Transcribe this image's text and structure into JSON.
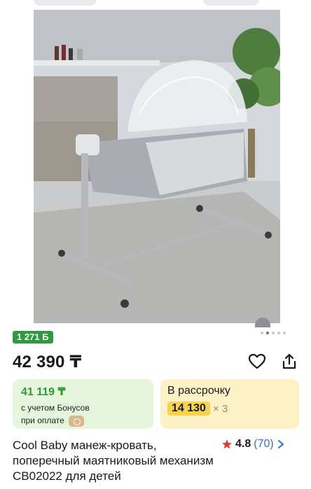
{
  "gallery": {
    "image_alt": "product photo",
    "dots_count": 5,
    "active_dot": 1
  },
  "bonus_badge": "1 271 Б",
  "price": "42 390 ₸",
  "actions": {
    "favorite_icon": "heart-icon",
    "share_icon": "share-icon"
  },
  "bonus_card": {
    "amount": "41 119 ₸",
    "line1": "с учетом Бонусов",
    "line2": "при оплате"
  },
  "installment_card": {
    "title": "В рассрочку",
    "amount": "14 130",
    "multiplier": "× 3"
  },
  "product": {
    "title": "Cool Baby манеж-кровать, поперечный маятниковый механизм CB02022 для детей"
  },
  "rating": {
    "score": "4.8",
    "count": "(70)"
  },
  "colors": {
    "green_badge": "#2e9b3f",
    "green_card": "#e6f6dd",
    "yellow_card": "#fdf2c6",
    "yellow_amount": "#f7d24a",
    "star": "#e03b3b",
    "link_blue": "#2f6fd6"
  }
}
